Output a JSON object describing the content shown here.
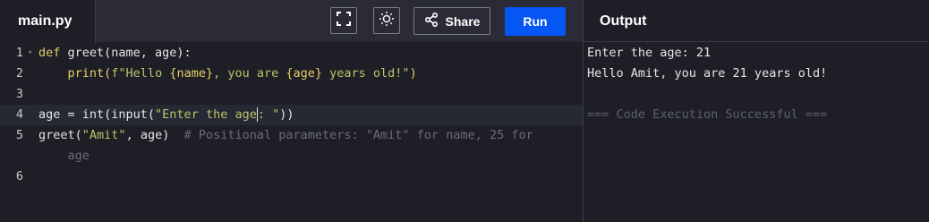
{
  "header": {
    "file_tab": "main.py",
    "share_label": "Share",
    "run_label": "Run",
    "output_title": "Output",
    "icons": [
      "fullscreen-icon",
      "theme-toggle-icon",
      "share-icon"
    ]
  },
  "editor": {
    "line_numbers": [
      "1",
      "2",
      "3",
      "4",
      "5",
      "6"
    ],
    "line1": {
      "kw": "def",
      "rest": " greet(name, age):"
    },
    "line2": {
      "indent": "    ",
      "fn": "print(",
      "str1": "f\"Hello ",
      "v1": "{name}",
      "str2": ", you are ",
      "v2": "{age}",
      "str3": " years old!\"",
      "close": ")"
    },
    "line4": {
      "pre": "age = int(input(",
      "str_a": "\"Enter the age",
      "str_b": ": \"",
      "close": "))"
    },
    "line5": {
      "pre": "greet(",
      "str": "\"Amit\"",
      "mid": ", age)  ",
      "comment": "# Positional parameters: \"Amit\" for name, 25 for",
      "comment_wrap": "    age"
    }
  },
  "output": {
    "lines": [
      "Enter the age: 21",
      "Hello Amit, you are 21 years old!",
      "",
      "=== Code Execution Successful ==="
    ]
  },
  "colors": {
    "run_button": "#0556f3",
    "keyword": "#e6cd69",
    "string": "#b8c56a",
    "comment": "#6a6c78"
  }
}
